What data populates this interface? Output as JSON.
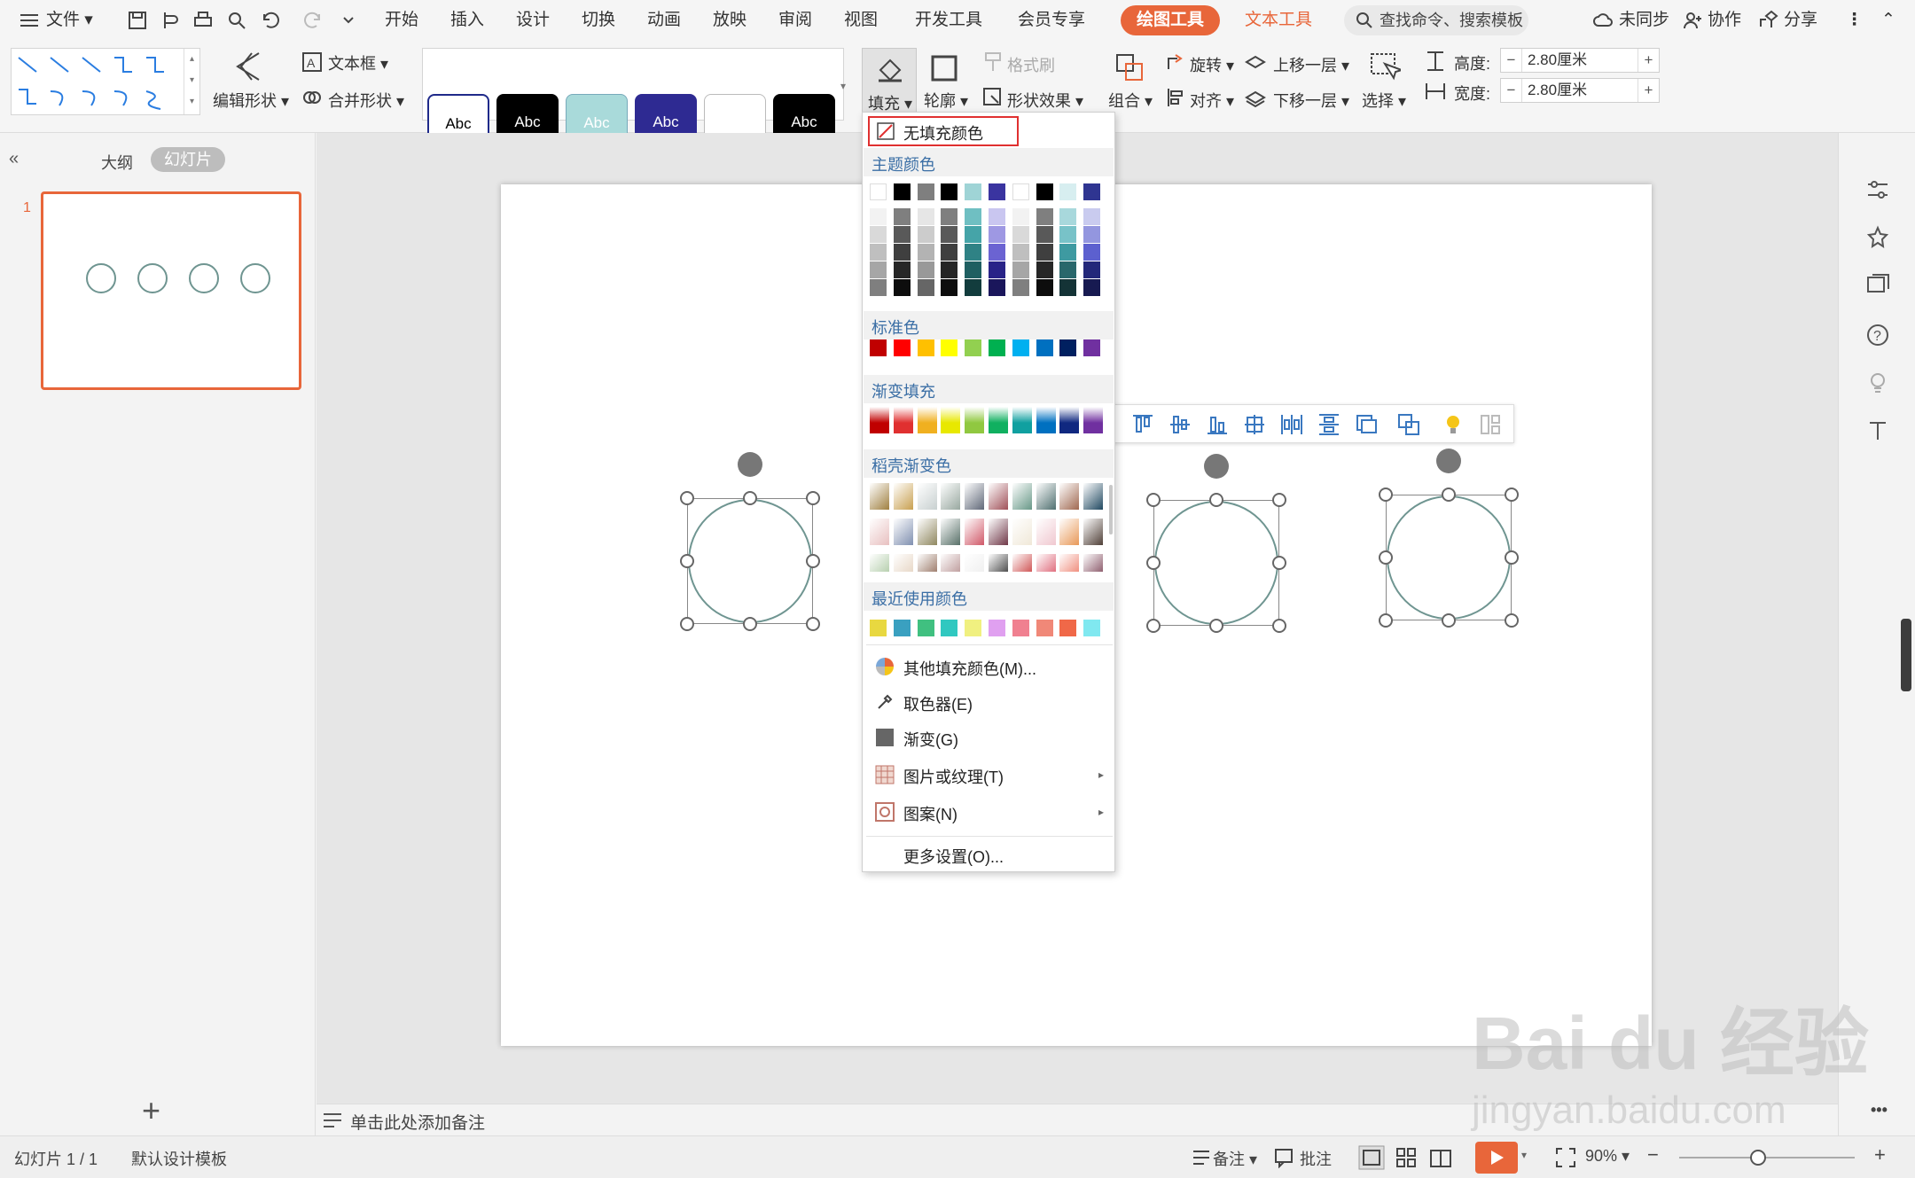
{
  "menubar": {
    "file_label": "文件",
    "tabs": [
      "开始",
      "插入",
      "设计",
      "切换",
      "动画",
      "放映",
      "审阅",
      "视图",
      "开发工具",
      "会员专享"
    ],
    "active_tab": "绘图工具",
    "text_tool_tab": "文本工具",
    "search_placeholder": "查找命令、搜索模板",
    "sync_label": "未同步",
    "collab_label": "协作",
    "share_label": "分享"
  },
  "ribbon": {
    "text_box": "文本框",
    "edit_shape": "编辑形状",
    "merge_shape": "合并形状",
    "style_label": "Abc",
    "fill": "填充",
    "outline": "轮廓",
    "format_painter": "格式刷",
    "shape_effect": "形状效果",
    "group": "组合",
    "rotate": "旋转",
    "align": "对齐",
    "bring_forward": "上移一层",
    "send_backward": "下移一层",
    "select": "选择",
    "height_label": "高度:",
    "width_label": "宽度:",
    "height_value": "2.80厘米",
    "width_value": "2.80厘米"
  },
  "leftpanel": {
    "outline_tab": "大纲",
    "slides_tab": "幻灯片",
    "slide_number": "1"
  },
  "dropdown": {
    "no_fill": "无填充颜色",
    "theme_colors": "主题颜色",
    "standard_colors": "标准色",
    "gradient_fill": "渐变填充",
    "daoke_gradient": "稻壳渐变色",
    "recent_colors": "最近使用颜色",
    "more_fill": "其他填充颜色(M)...",
    "eyedropper": "取色器(E)",
    "gradient": "渐变(G)",
    "picture_texture": "图片或纹理(T)",
    "pattern": "图案(N)",
    "more_settings": "更多设置(O)...",
    "theme_top_row": [
      "#ffffff",
      "#000000",
      "#7f7f7f",
      "#000000",
      "#9fd4d6",
      "#3a34a0",
      "#ffffff",
      "#000000",
      "#d7eef0",
      "#2f3591"
    ],
    "standard": [
      "#c00000",
      "#ff0000",
      "#ffc000",
      "#ffff00",
      "#92d050",
      "#00b050",
      "#00b0f0",
      "#0070c0",
      "#002060",
      "#7030a0"
    ],
    "gradient_row": [
      "#c00000",
      "#e03030",
      "#f0b020",
      "#e8e800",
      "#90c840",
      "#10b060",
      "#10a0a0",
      "#0070c0",
      "#102880",
      "#7030a0"
    ],
    "recent": [
      "#e8d840",
      "#3aa0c0",
      "#40c080",
      "#30c8c0",
      "#f0f080",
      "#e0a0f0",
      "#f08090",
      "#f08878",
      "#f06848",
      "#80e8f0"
    ]
  },
  "notes": {
    "add_notes": "单击此处添加备注"
  },
  "statusbar": {
    "slide_count": "幻灯片 1 / 1",
    "template": "默认设计模板",
    "notes_btn": "备注",
    "comments_btn": "批注",
    "zoom": "90%"
  },
  "watermark": {
    "line1": "Bai du 经验",
    "line2": "jingyan.baidu.com"
  }
}
